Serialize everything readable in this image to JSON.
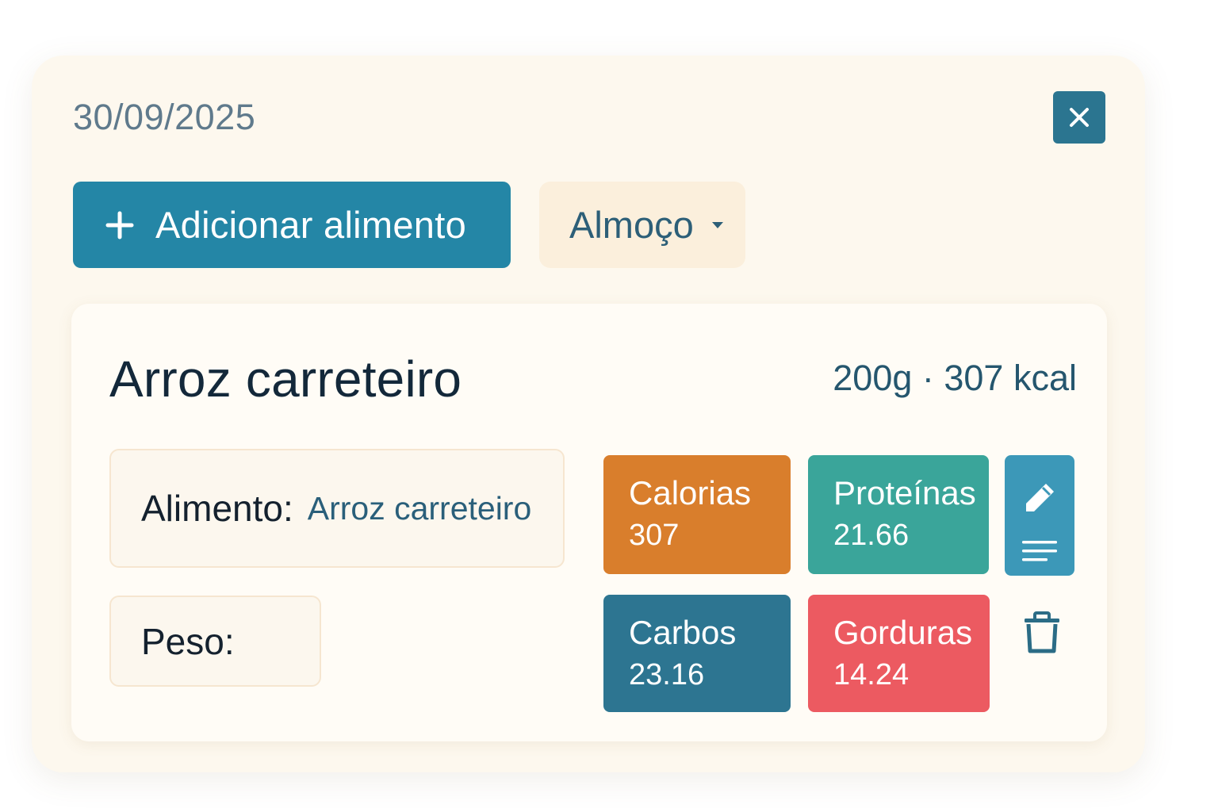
{
  "header": {
    "date": "30/09/2025",
    "close_icon": "close-icon"
  },
  "toolbar": {
    "add_label": "Adicionar alimento",
    "add_icon": "plus-icon",
    "meal_selected": "Almoço",
    "meal_icon": "chevron-down-icon"
  },
  "entry": {
    "title": "Arroz carreteiro",
    "summary": "200g · 307 kcal",
    "fields": {
      "food_label": "Alimento:",
      "food_value": "Arroz carreteiro",
      "weight_label": "Peso:"
    },
    "macros": {
      "calories": {
        "label": "Calorias",
        "value": "307",
        "color": "#d97e2c"
      },
      "protein": {
        "label": "Proteínas",
        "value": "21.66",
        "color": "#3aa59a"
      },
      "carbs": {
        "label": "Carbos",
        "value": "23.16",
        "color": "#2d7591"
      },
      "fat": {
        "label": "Gorduras",
        "value": "14.24",
        "color": "#ec5a61"
      }
    },
    "actions": {
      "edit_icon": "pencil-icon",
      "notes_icon": "lines-icon",
      "delete_icon": "trash-icon"
    }
  },
  "colors": {
    "accent": "#2486a6",
    "panel_bg": "#fdf8ee",
    "text_dark": "#13283a"
  }
}
